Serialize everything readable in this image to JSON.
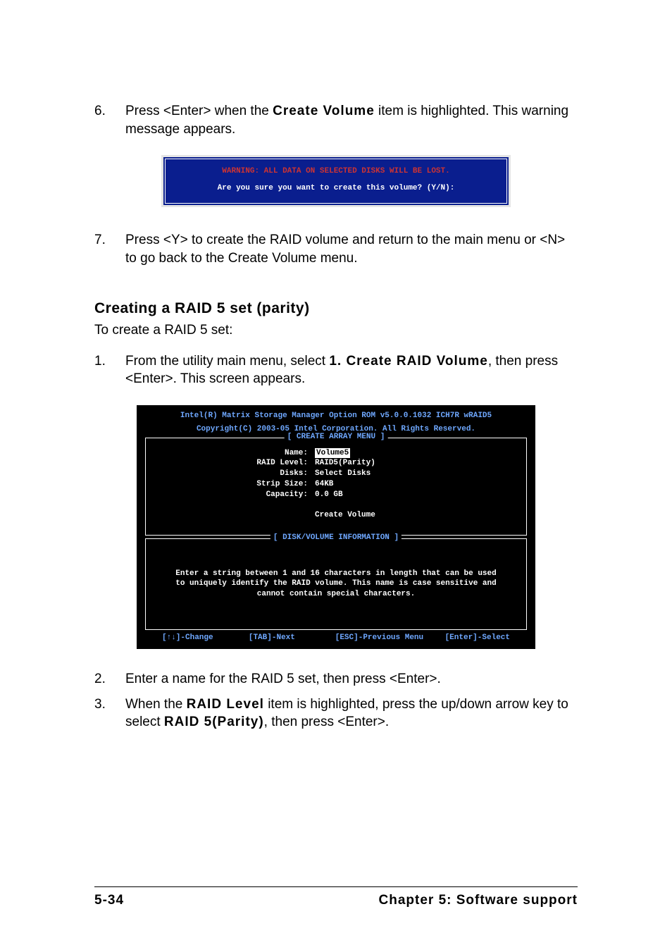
{
  "steps_a": {
    "s6_num": "6.",
    "s6_a": "Press <Enter> when the ",
    "s6_bold": "Create Volume",
    "s6_b": " item is highlighted. This warning message appears.",
    "s7_num": "7.",
    "s7": "Press <Y> to create the RAID volume and return to the main menu or <N> to go back to the Create Volume menu."
  },
  "term1": {
    "warn": "WARNING: ALL DATA ON SELECTED DISKS WILL BE LOST.",
    "prompt": "Are you sure you want to create this volume? (Y/N):"
  },
  "heading": "Creating a RAID 5 set (parity)",
  "subtext": "To create a RAID 5 set:",
  "steps_b": {
    "s1_num": "1.",
    "s1_a": "From the utility main menu, select ",
    "s1_bold": "1. Create RAID Volume",
    "s1_b": ", then press <Enter>. This screen appears.",
    "s2_num": "2.",
    "s2": "Enter a name for the RAID 5 set, then press <Enter>.",
    "s3_num": "3.",
    "s3_a": "When the ",
    "s3_bold1": "RAID Level",
    "s3_b": " item is highlighted, press the up/down arrow key to select ",
    "s3_bold2": "RAID 5(Parity)",
    "s3_c": ", then press <Enter>."
  },
  "term2": {
    "header1": "Intel(R) Matrix Storage Manager Option ROM v5.0.0.1032 ICH7R wRAID5",
    "header2": "Copyright(C) 2003-05 Intel Corporation. All Rights Reserved.",
    "box1_title": "[ CREATE ARRAY MENU ]",
    "fields": {
      "name_l": "Name:",
      "name_v": "Volume5",
      "raid_l": "RAID Level:",
      "raid_v": "RAID5(Parity)",
      "disks_l": "Disks:",
      "disks_v": "Select Disks",
      "strip_l": "Strip Size:",
      "strip_v": "64KB",
      "cap_l": "Capacity:",
      "cap_v": "0.0  GB",
      "create": "Create Volume"
    },
    "box2_title": "[ DISK/VOLUME INFORMATION ]",
    "help1": "Enter a string between 1 and 16 characters in length that can be used",
    "help2": "to uniquely identify the RAID volume. This name is case sensitive and",
    "help3": "cannot contain special characters.",
    "keys": {
      "k1": "[↑↓]-Change",
      "k2": "[TAB]-Next",
      "k3": "[ESC]-Previous Menu",
      "k4": "[Enter]-Select"
    }
  },
  "footer": {
    "left": "5-34",
    "right": "Chapter 5: Software support"
  }
}
